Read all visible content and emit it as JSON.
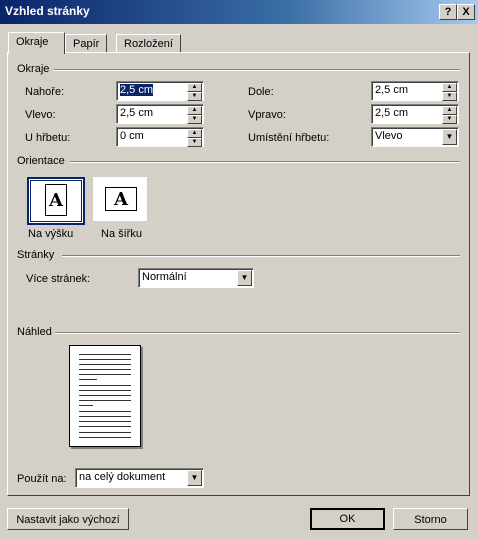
{
  "window": {
    "title": "Vzhled stránky",
    "help_button": "?",
    "close_button": "X"
  },
  "tabs": [
    "Okraje",
    "Papír",
    "Rozložení"
  ],
  "margins": {
    "section_label": "Okraje",
    "top_label": "Nahoře:",
    "top_value": "2,5 cm",
    "bottom_label": "Dole:",
    "bottom_value": "2,5 cm",
    "left_label": "Vlevo:",
    "left_value": "2,5 cm",
    "right_label": "Vpravo:",
    "right_value": "2,5 cm",
    "gutter_label": "U hřbetu:",
    "gutter_value": "0 cm",
    "gutter_pos_label": "Umístění hřbetu:",
    "gutter_pos_value": "Vlevo"
  },
  "orientation": {
    "section_label": "Orientace",
    "portrait_label": "Na výšku",
    "landscape_label": "Na šířku",
    "glyph": "A"
  },
  "pages": {
    "section_label": "Stránky",
    "multiple_label": "Více stránek:",
    "multiple_value": "Normální"
  },
  "preview": {
    "section_label": "Náhled",
    "apply_label": "Použít na:",
    "apply_value": "na celý dokument"
  },
  "buttons": {
    "default": "Nastavit jako výchozí",
    "ok": "OK",
    "cancel": "Storno"
  }
}
